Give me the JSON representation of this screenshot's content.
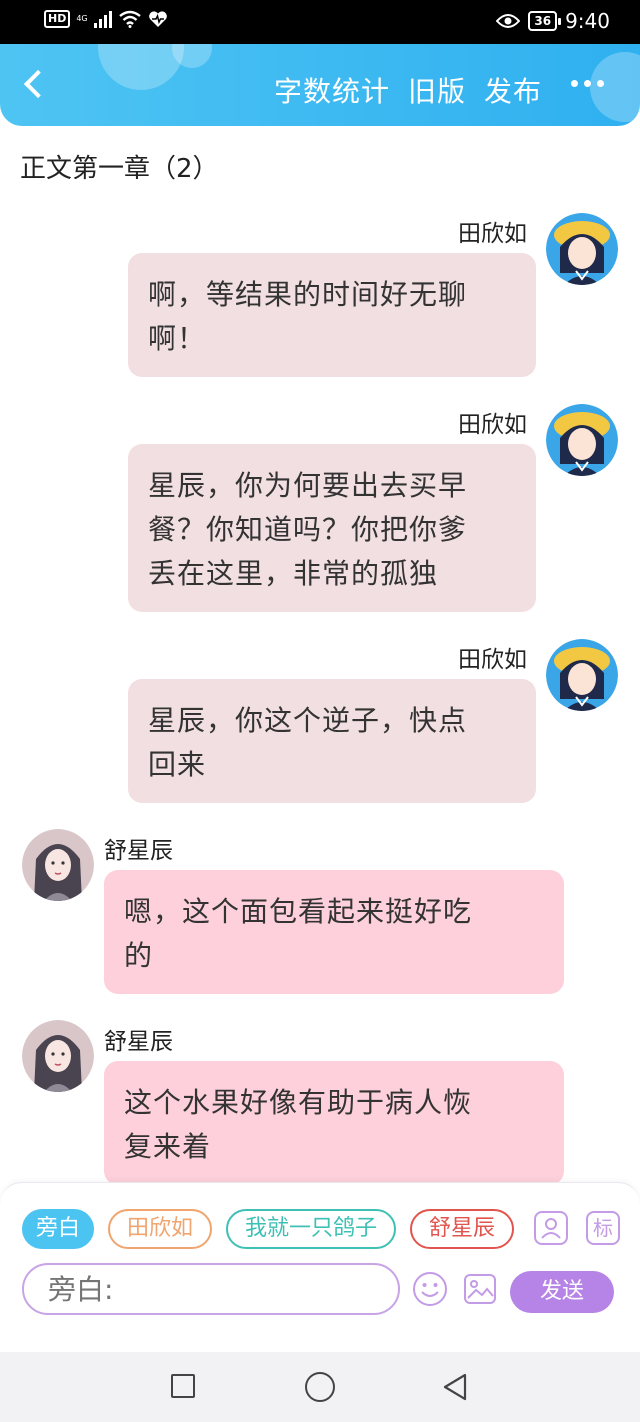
{
  "status_bar": {
    "hd": "HD",
    "network": "4G",
    "battery": "36",
    "time": "9:40"
  },
  "header": {
    "actions": [
      "字数统计",
      "旧版",
      "发布"
    ],
    "bg_color": "#2fb0f0"
  },
  "chapter_title": "正文第一章（2）",
  "messages": [
    {
      "side": "right",
      "name": "田欣如",
      "text_lines": [
        "啊，等结果的时间好无聊",
        "啊！"
      ]
    },
    {
      "side": "right",
      "name": "田欣如",
      "text_lines": [
        "星辰，你为何要出去买早",
        "餐？你知道吗？你把你爹",
        "丢在这里，非常的孤独"
      ]
    },
    {
      "side": "right",
      "name": "田欣如",
      "text_lines": [
        "星辰，你这个逆子，快点",
        "回来"
      ]
    },
    {
      "side": "left",
      "name": "舒星辰",
      "text_lines": [
        "嗯，这个面包看起来挺好吃",
        "的"
      ]
    },
    {
      "side": "left",
      "name": "舒星辰",
      "text_lines": [
        "这个水果好像有助于病人恢",
        "复来着"
      ]
    }
  ],
  "composer": {
    "roles": [
      {
        "label": "旁白",
        "active": true,
        "color": "#4cc4f2"
      },
      {
        "label": "田欣如",
        "active": false,
        "color": "#f0a46e"
      },
      {
        "label": "我就一只鸽子",
        "active": false,
        "color": "#3fc0b4"
      },
      {
        "label": "舒星辰",
        "active": false,
        "color": "#e2544e"
      }
    ],
    "mark_label": "标",
    "input_placeholder": "旁白:",
    "send_label": "发送"
  },
  "colors": {
    "right_bubble": "#f2dfe1",
    "left_bubble": "#fdd0db",
    "accent_purple": "#b683e6"
  }
}
